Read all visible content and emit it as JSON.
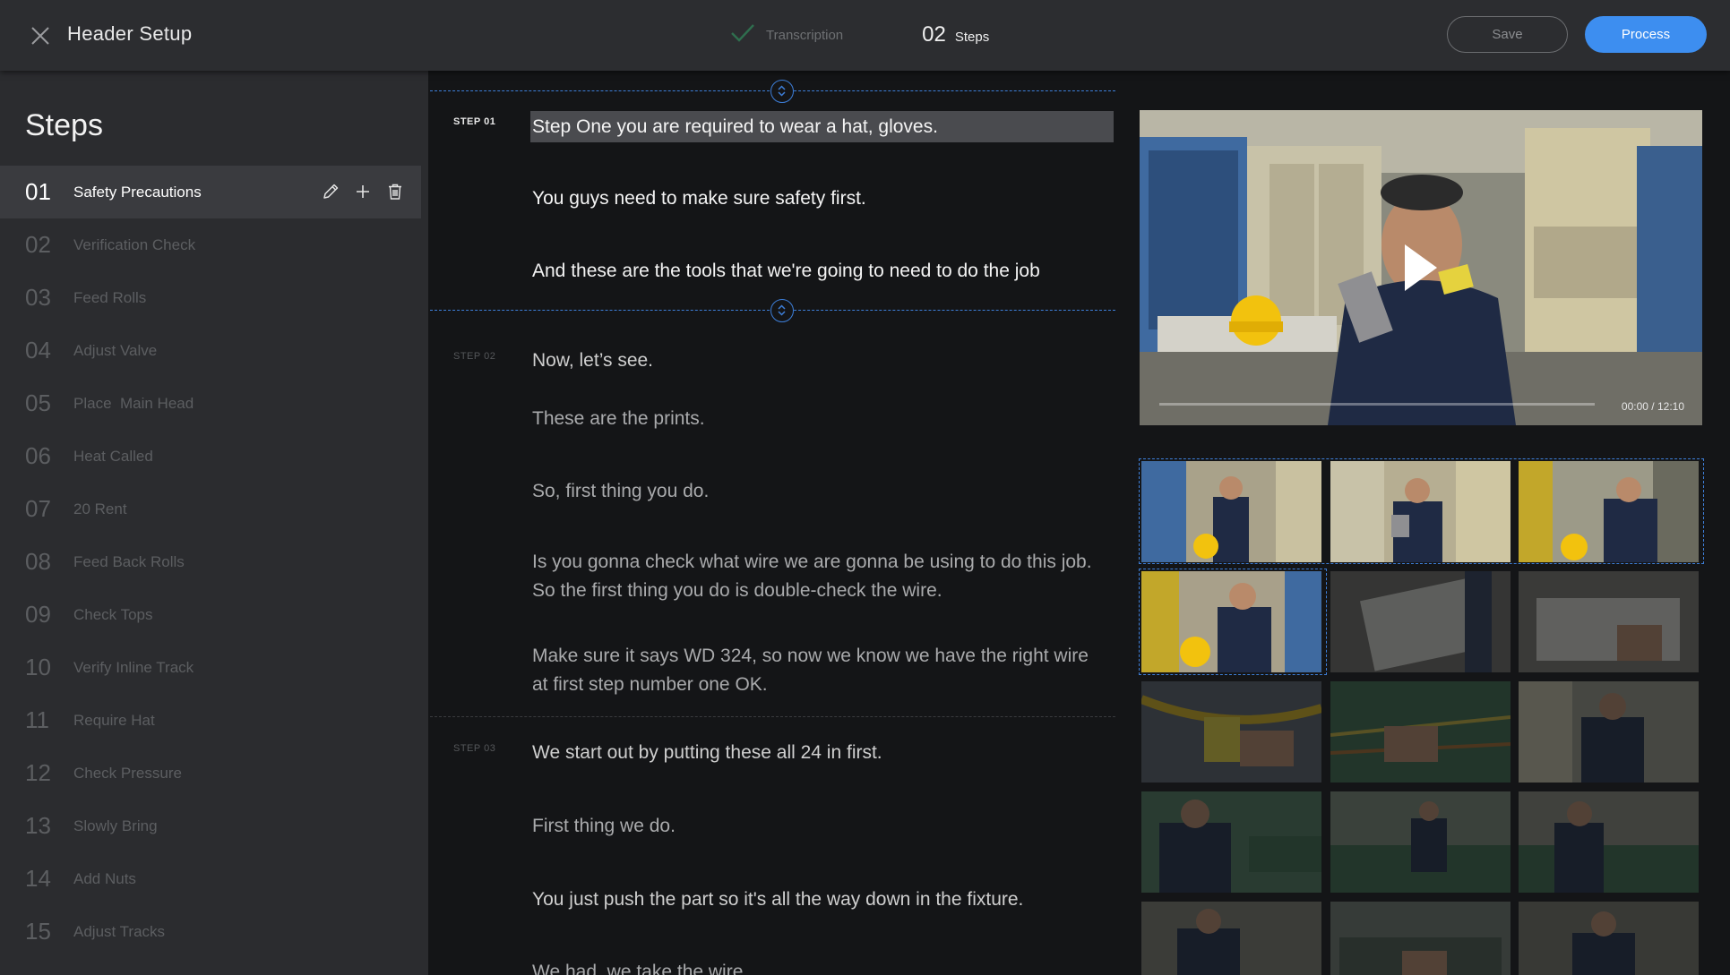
{
  "header": {
    "title": "Header Setup",
    "stage_done_label": "Transcription",
    "stage_current_number": "02",
    "stage_current_label": "Steps",
    "save_label": "Save",
    "process_label": "Process"
  },
  "sidebar": {
    "title": "Steps",
    "items": [
      {
        "num": "01",
        "label": "Safety Precautions"
      },
      {
        "num": "02",
        "label": "Verification Check"
      },
      {
        "num": "03",
        "label": "Feed Rolls"
      },
      {
        "num": "04",
        "label": "Adjust Valve"
      },
      {
        "num": "05",
        "label": "Place  Main Head"
      },
      {
        "num": "06",
        "label": "Heat Called"
      },
      {
        "num": "07",
        "label": "20 Rent"
      },
      {
        "num": "08",
        "label": "Feed Back Rolls"
      },
      {
        "num": "09",
        "label": "Check Tops"
      },
      {
        "num": "10",
        "label": "Verify Inline Track"
      },
      {
        "num": "11",
        "label": "Require Hat"
      },
      {
        "num": "12",
        "label": "Check Pressure"
      },
      {
        "num": "13",
        "label": "Slowly Bring"
      },
      {
        "num": "14",
        "label": "Add Nuts"
      },
      {
        "num": "15",
        "label": "Adjust Tracks"
      }
    ]
  },
  "transcript": {
    "step1_tag": "STEP 01",
    "step2_tag": "STEP 02",
    "step3_tag": "STEP 03",
    "step1_lines": [
      "Step One you are required to wear a hat, gloves.",
      "You guys need to make sure safety first.",
      "And these are the tools that we're going to need to do the job"
    ],
    "step2_lines": [
      "Now, let’s see.",
      "These are the prints.",
      "So, first thing you do.",
      "Is you gonna check what wire we are gonna be using to do this job. So the first thing you do is double-check the wire.",
      "Make sure it says WD 324, so now we know we have the right wire at first step number one OK."
    ],
    "step3_lines": [
      "We start out by putting these all 24 in first.",
      "First thing we do.",
      "You just push the part so it's all the way down in the fixture.",
      "We had, we take the wire"
    ]
  },
  "video": {
    "current_time": "00:00",
    "separator": "/",
    "duration": "12:10",
    "progress": 0
  },
  "colors": {
    "accent": "#3d8ef0",
    "topbar": "#2c2d30",
    "sidebar": "#2b2c2f",
    "panel": "#141517"
  },
  "icons": {
    "close": "close-icon",
    "check": "check-icon",
    "edit": "pencil-icon",
    "add": "plus-icon",
    "delete": "trash-icon",
    "handle": "drag-handle-icon",
    "play": "play-icon"
  }
}
